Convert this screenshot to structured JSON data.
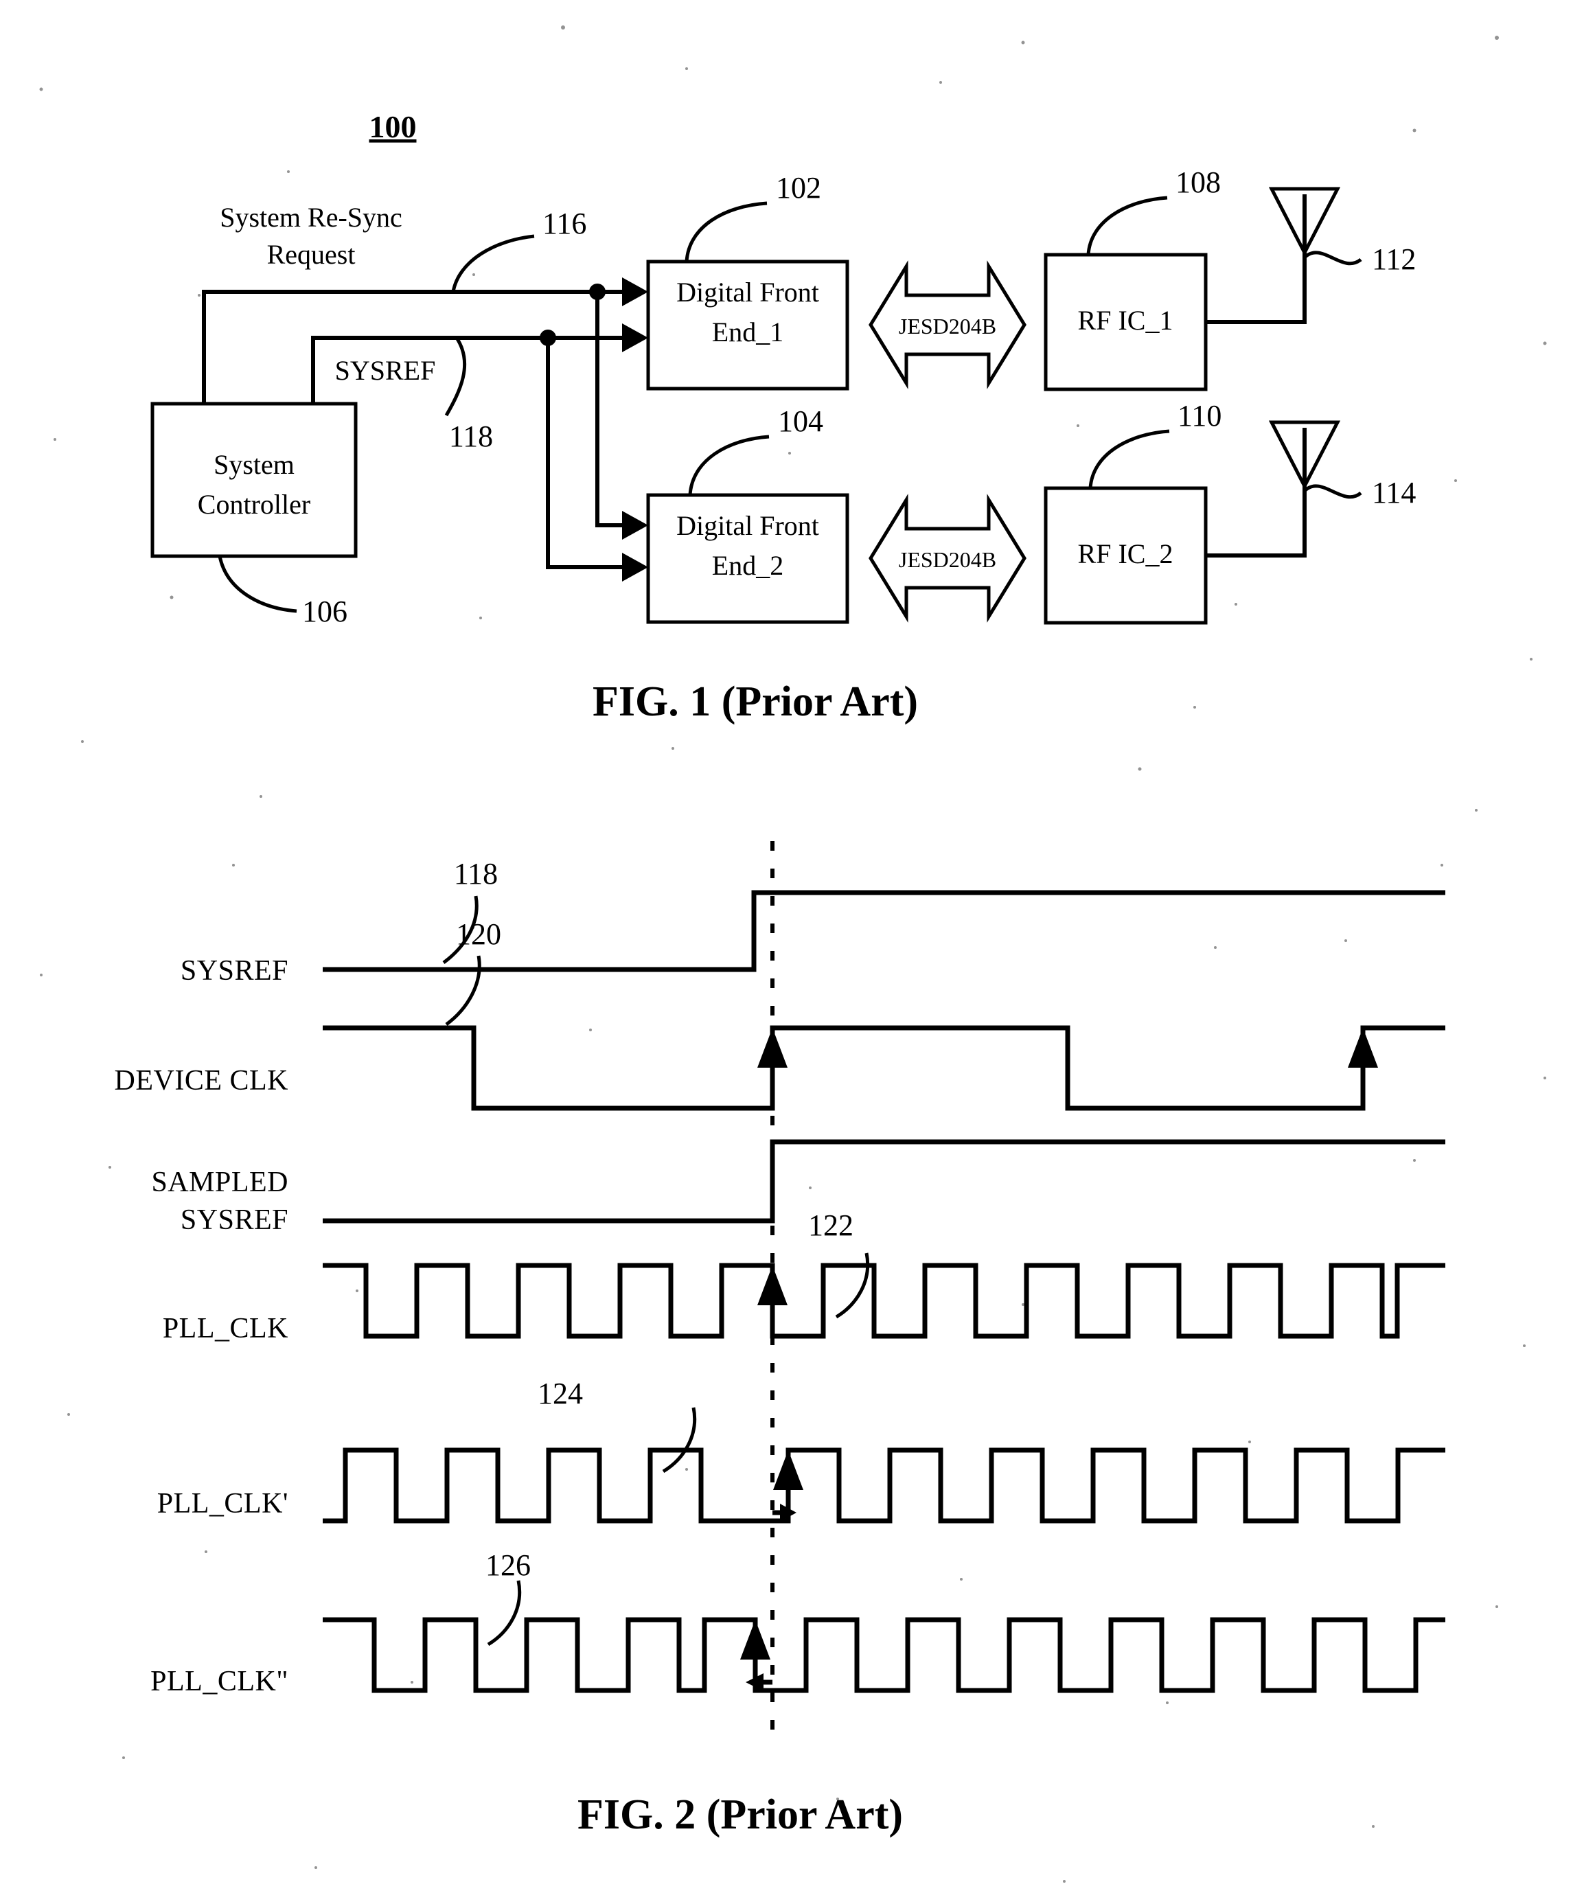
{
  "figure1": {
    "title_number": "100",
    "caption": "FIG. 1 (Prior Art)",
    "blocks": [
      {
        "id": "dfe1",
        "label_line1": "Digital Front",
        "label_line2": "End_1",
        "ref": "102"
      },
      {
        "id": "dfe2",
        "label_line1": "Digital Front",
        "label_line2": "End_2",
        "ref": "104"
      },
      {
        "id": "sysctrl",
        "label_line1": "System",
        "label_line2": "Controller",
        "ref": "106"
      },
      {
        "id": "rfic1",
        "label_line1": "RF IC_1",
        "label_line2": "",
        "ref": "108"
      },
      {
        "id": "rfic2",
        "label_line1": "RF IC_2",
        "label_line2": "",
        "ref": "110"
      }
    ],
    "bus_labels": [
      "JESD204B",
      "JESD204B"
    ],
    "signal_labels": [
      {
        "text_line1": "System Re-Sync",
        "text_line2": "Request",
        "ref": "116"
      },
      {
        "text_line1": "SYSREF",
        "text_line2": "",
        "ref": "118"
      }
    ],
    "antennas": [
      {
        "ref": "112"
      },
      {
        "ref": "114"
      }
    ]
  },
  "figure2": {
    "caption": "FIG. 2 (Prior Art)",
    "signals": [
      {
        "name": "SYSREF",
        "ref": "118"
      },
      {
        "name_line1": "DEVICE CLK",
        "name": "DEVICE CLK",
        "ref": "120"
      },
      {
        "name_line1": "SAMPLED",
        "name_line2": "SYSREF",
        "name": "SAMPLED SYSREF",
        "ref": ""
      },
      {
        "name": "PLL_CLK",
        "ref": "122"
      },
      {
        "name": "PLL_CLK'",
        "ref": "124"
      },
      {
        "name": "PLL_CLK\"",
        "ref": "126"
      }
    ]
  },
  "chart_data": {
    "type": "line",
    "title": "FIG. 2 (Prior Art)",
    "xlabel": "",
    "ylabel": "",
    "notes": "Digital timing waveform diagram. Vertical dotted reference line at the SYSREF rising edge.",
    "reference_line_x": 1125,
    "series": [
      {
        "name": "SYSREF",
        "ref": "118",
        "type": "step",
        "levels": [
          {
            "x_start": 470,
            "x_end": 1098,
            "value": 0
          },
          {
            "x_start": 1098,
            "x_end": 2105,
            "value": 1
          }
        ]
      },
      {
        "name": "DEVICE CLK",
        "ref": "120",
        "type": "step",
        "levels": [
          {
            "x_start": 470,
            "x_end": 690,
            "value": 1
          },
          {
            "x_start": 690,
            "x_end": 1125,
            "value": 0
          },
          {
            "x_start": 1125,
            "x_end": 1555,
            "value": 1
          },
          {
            "x_start": 1555,
            "x_end": 1985,
            "value": 0
          },
          {
            "x_start": 1985,
            "x_end": 2105,
            "value": 1
          }
        ],
        "rising_edge_markers": [
          1125,
          1985
        ]
      },
      {
        "name": "SAMPLED SYSREF",
        "ref": "",
        "type": "step",
        "levels": [
          {
            "x_start": 470,
            "x_end": 1125,
            "value": 0
          },
          {
            "x_start": 1125,
            "x_end": 2105,
            "value": 1
          }
        ]
      },
      {
        "name": "PLL_CLK",
        "ref": "122",
        "type": "square",
        "period": 148,
        "duty": 0.5,
        "phase_offset": 0,
        "start_level": 1,
        "x_start": 470,
        "x_end": 2105,
        "rising_edge_markers": [
          1125
        ]
      },
      {
        "name": "PLL_CLK'",
        "ref": "124",
        "type": "square",
        "period": 148,
        "duty": 0.5,
        "phase_offset": 24,
        "start_level": 0,
        "x_start": 470,
        "x_end": 2105,
        "rising_edge_markers": [
          1148
        ],
        "skew_arrow": "right"
      },
      {
        "name": "PLL_CLK\"",
        "ref": "126",
        "type": "square",
        "period": 148,
        "duty": 0.5,
        "phase_offset": -22,
        "start_level": 1,
        "x_start": 470,
        "x_end": 2105,
        "rising_edge_markers": [
          1100
        ],
        "skew_arrow": "left"
      }
    ]
  }
}
